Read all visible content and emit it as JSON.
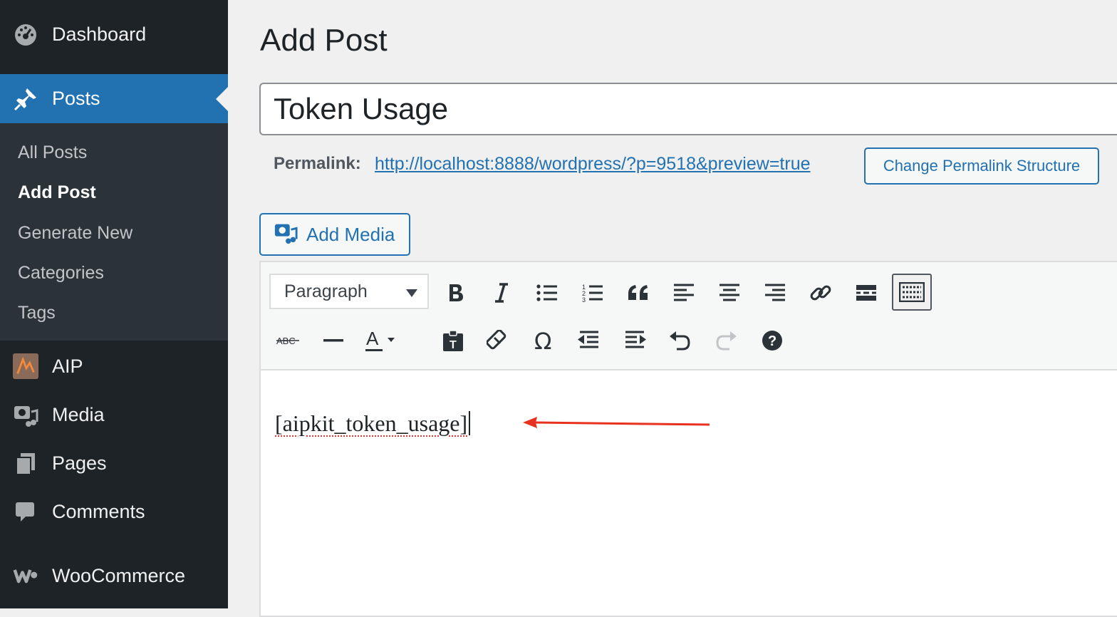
{
  "sidebar": {
    "items": [
      {
        "label": "Dashboard",
        "icon": "dashboard-icon"
      },
      {
        "label": "Posts",
        "icon": "pushpin-icon"
      },
      {
        "label": "AIP",
        "icon": "aip-logo-icon"
      },
      {
        "label": "Media",
        "icon": "media-icon"
      },
      {
        "label": "Pages",
        "icon": "pages-icon"
      },
      {
        "label": "Comments",
        "icon": "comments-icon"
      },
      {
        "label": "WooCommerce",
        "icon": "woocommerce-icon"
      }
    ],
    "posts_submenu": [
      "All Posts",
      "Add Post",
      "Generate New",
      "Categories",
      "Tags"
    ],
    "active_item": "Posts",
    "current_subitem": "Add Post"
  },
  "main": {
    "page_title": "Add Post",
    "post_title_value": "Token Usage",
    "permalink_label": "Permalink:",
    "permalink_url": "http://localhost:8888/wordpress/?p=9518&preview=true",
    "change_permalink_button": "Change Permalink Structure",
    "add_media_button": "Add Media"
  },
  "editor": {
    "format_select_value": "Paragraph",
    "toolbar_row1": [
      "bold-icon",
      "italic-icon",
      "bullet-list-icon",
      "numbered-list-icon",
      "blockquote-icon",
      "align-left-icon",
      "align-center-icon",
      "align-right-icon",
      "link-icon",
      "read-more-icon",
      "toolbar-toggle-icon"
    ],
    "toolbar_row2": [
      "strikethrough-icon",
      "horizontal-line-icon",
      "text-color-icon",
      "paste-text-icon",
      "clear-formatting-icon",
      "special-character-icon",
      "outdent-icon",
      "indent-icon",
      "undo-icon",
      "redo-icon",
      "help-icon"
    ],
    "content_text": "[aipkit_token_usage]"
  },
  "colors": {
    "sidebar_bg": "#1d2327",
    "submenu_bg": "#2c3338",
    "accent": "#2271b1",
    "annotation_arrow": "#e8321f"
  }
}
